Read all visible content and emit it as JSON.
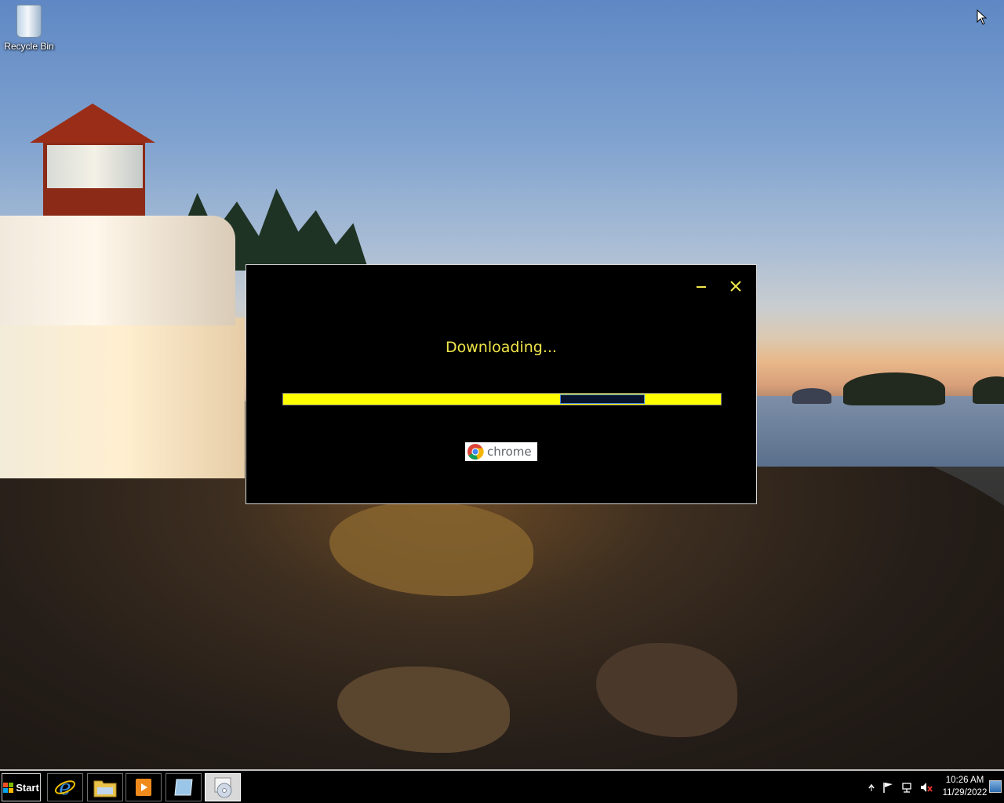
{
  "desktop": {
    "icons": [
      {
        "label": "Recycle Bin",
        "icon": "recycle-bin-icon"
      }
    ]
  },
  "dialog": {
    "status_text": "Downloading...",
    "progress": {
      "style": "marquee",
      "fill_color": "#ffff00",
      "indicator_color": "#06122c"
    },
    "badge_label": "chrome",
    "badge_icon": "chrome-logo-icon",
    "minimize_icon": "minimize-icon",
    "close_icon": "close-icon",
    "accent_color": "#f1e64a"
  },
  "taskbar": {
    "start_label": "Start",
    "pinned": [
      {
        "name": "internet-explorer",
        "icon": "internet-explorer-icon"
      },
      {
        "name": "file-explorer",
        "icon": "folder-icon"
      },
      {
        "name": "media-player",
        "icon": "media-player-icon"
      },
      {
        "name": "app-window",
        "icon": "window-icon"
      },
      {
        "name": "installer",
        "icon": "installer-disc-icon",
        "active": true
      }
    ],
    "tray": {
      "icons": [
        "chevron-up-icon",
        "flag-icon",
        "network-icon",
        "volume-muted-icon"
      ]
    },
    "clock": {
      "time": "10:26 AM",
      "date": "11/29/2022"
    }
  }
}
